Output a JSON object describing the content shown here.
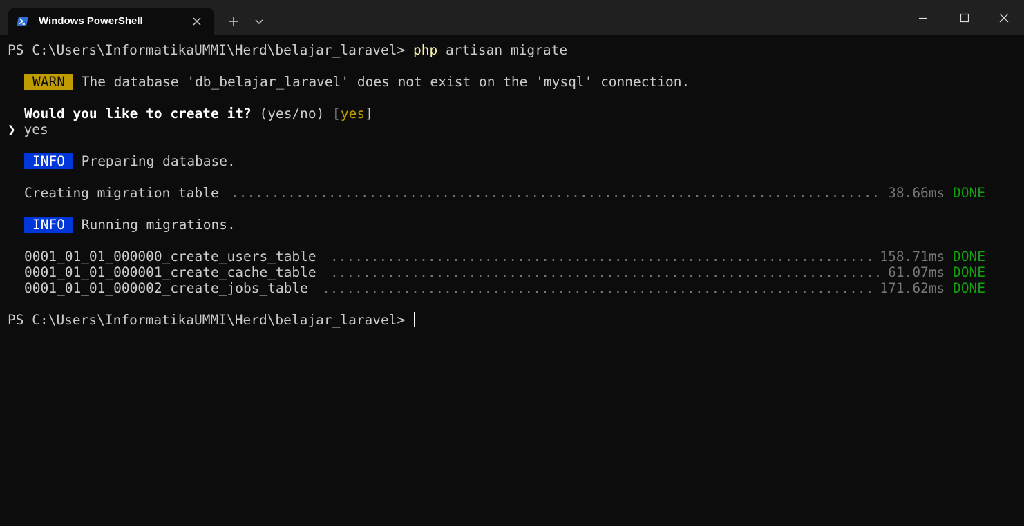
{
  "window": {
    "tab_title": "Windows PowerShell",
    "tab_icon": "powershell-icon",
    "new_tab_icon": "plus-icon",
    "dropdown_icon": "chevron-down-icon",
    "minimize_icon": "minimize-icon",
    "maximize_icon": "maximize-icon",
    "close_icon": "close-icon"
  },
  "colors": {
    "background": "#0c0c0c",
    "titlebar": "#202020",
    "foreground": "#cccccc",
    "warn": "#c19c00",
    "info": "#0037da",
    "done": "#13a10e",
    "command": "#f9f1a5"
  },
  "terminal": {
    "prompt1": {
      "prompt": "PS C:\\Users\\InformatikaUMMI\\Herd\\belajar_laravel> ",
      "cmd_name": "php",
      "cmd_args": " artisan migrate"
    },
    "warn": {
      "badge": "WARN",
      "message": " The database 'db_belajar_laravel' does not exist on the 'mysql' connection."
    },
    "question": {
      "text": "Would you like to create it?",
      "options": " (yes/no) [",
      "default": "yes",
      "close": "]"
    },
    "answer": {
      "marker": "❯",
      "text": " yes"
    },
    "info1": {
      "badge": "INFO",
      "message": " Preparing database."
    },
    "creating": {
      "label": "Creating migration table",
      "time": "38.66ms",
      "status": "DONE"
    },
    "info2": {
      "badge": "INFO",
      "message": " Running migrations."
    },
    "migrations": [
      {
        "name": "0001_01_01_000000_create_users_table",
        "time": "158.71ms",
        "status": "DONE"
      },
      {
        "name": "0001_01_01_000001_create_cache_table",
        "time": "61.07ms",
        "status": "DONE"
      },
      {
        "name": "0001_01_01_000002_create_jobs_table",
        "time": "171.62ms",
        "status": "DONE"
      }
    ],
    "prompt2": {
      "prompt": "PS C:\\Users\\InformatikaUMMI\\Herd\\belajar_laravel> "
    }
  }
}
